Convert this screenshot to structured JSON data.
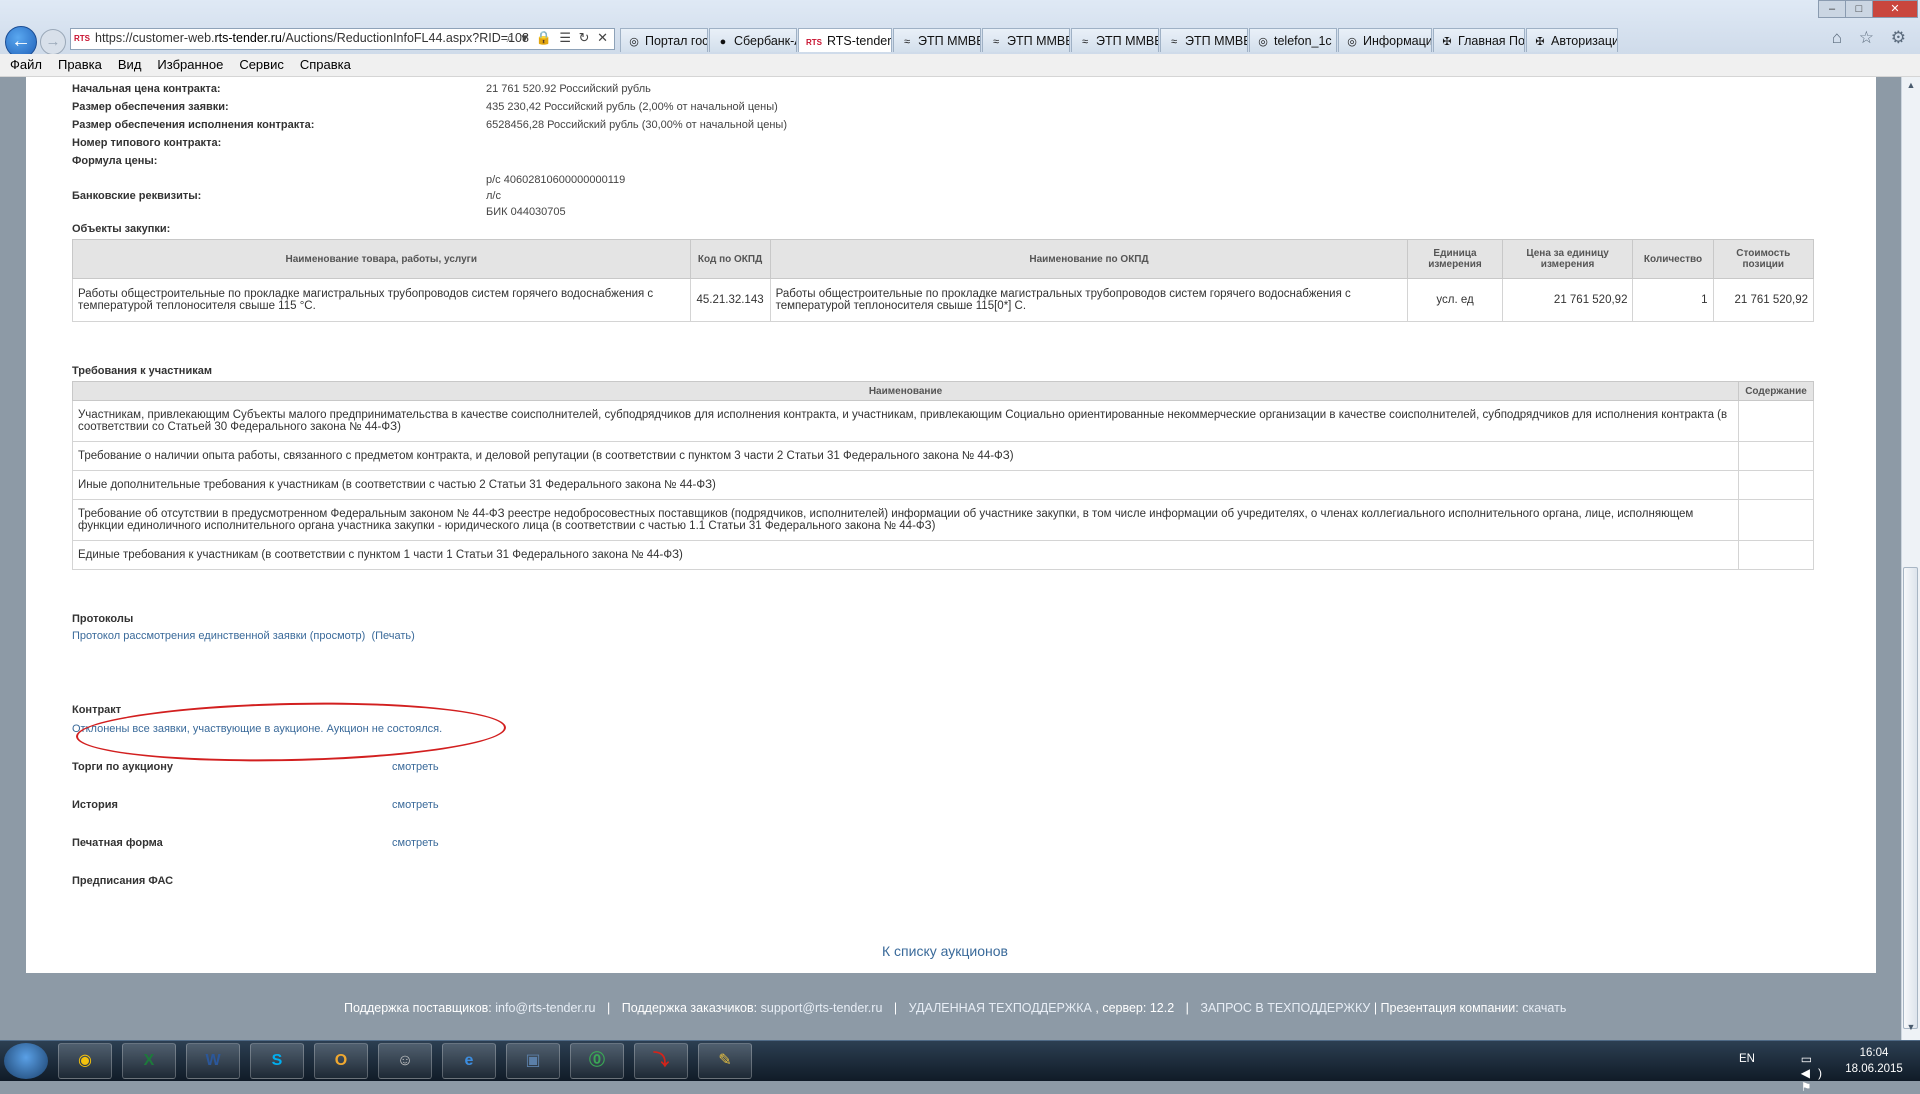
{
  "browser": {
    "url_prefix": "https://customer-web.",
    "url_domain": "rts-tender.ru",
    "url_path": "/Auctions/ReductionInfoFL44.aspx?RID=108",
    "url_icons": "⌕ ▾ 🔒 ☰ ↻ ✕",
    "favicon_text": "RTS",
    "tabs": [
      {
        "label": "Портал госз...",
        "icon": "◎",
        "active": false
      },
      {
        "label": "Сбербанк-А...",
        "icon": "●",
        "active": false
      },
      {
        "label": "RTS-tender",
        "icon": "RTS",
        "active": true
      },
      {
        "label": "ЭТП ММВБ «...",
        "icon": "≈",
        "active": false
      },
      {
        "label": "ЭТП ММВБ «...",
        "icon": "≈",
        "active": false
      },
      {
        "label": "ЭТП ММВБ «...",
        "icon": "≈",
        "active": false
      },
      {
        "label": "ЭТП ММВБ «...",
        "icon": "≈",
        "active": false
      },
      {
        "label": "telefon_1c",
        "icon": "◎",
        "active": false
      },
      {
        "label": "Информация",
        "icon": "◎",
        "active": false
      },
      {
        "label": "Главная Пор...",
        "icon": "✠",
        "active": false
      },
      {
        "label": "Авторизация...",
        "icon": "✠",
        "active": false
      }
    ],
    "tab_close": "✕",
    "menu": [
      "Файл",
      "Правка",
      "Вид",
      "Избранное",
      "Сервис",
      "Справка"
    ],
    "right_icons": "⌂ ☆ ⚙",
    "window_controls": {
      "minimize": "–",
      "maximize": "□",
      "close": "✕"
    }
  },
  "info": [
    {
      "label": "Начальная цена контракта:",
      "value": "21 761 520.92 Российский рубль"
    },
    {
      "label": "Размер обеспечения заявки:",
      "value": "435 230,42 Российский рубль (2,00% от начальной цены)"
    },
    {
      "label": "Размер обеспечения исполнения контракта:",
      "value": "6528456,28 Российский рубль (30,00% от начальной цены)"
    },
    {
      "label": "Номер типового контракта:",
      "value": ""
    },
    {
      "label": "Формула цены:",
      "value": ""
    }
  ],
  "bank": {
    "label": "Банковские реквизиты:",
    "lines": [
      "р/с 40602810600000000119",
      "л/с",
      "БИК 044030705"
    ]
  },
  "goods": {
    "title": "Объекты закупки:",
    "headers": [
      "Наименование товара, работы, услуги",
      "Код по ОКПД",
      "Наименование по ОКПД",
      "Единица измерения",
      "Цена за единицу измерения",
      "Количество",
      "Стоимость позиции"
    ],
    "row": {
      "name": "Работы общестроительные по прокладке магистральных трубопроводов систем горячего водоснабжения с температурой теплоносителя свыше 115 °С.",
      "okpd": "45.21.32.143",
      "okpd_name": "Работы общестроительные по прокладке магистральных трубопроводов систем горячего водоснабжения с температурой теплоносителя свыше 115[0*] С.",
      "unit": "усл. ед",
      "price": "21 761 520,92",
      "qty": "1",
      "total": "21 761 520,92"
    }
  },
  "requirements": {
    "title": "Требования к участникам",
    "headers": [
      "Наименование",
      "Содержание"
    ],
    "rows": [
      "Участникам, привлекающим Субъекты малого предпринимательства в качестве соисполнителей, субподрядчиков для исполнения контракта, и участникам, привлекающим Социально ориентированные некоммерческие организации в качестве соисполнителей, субподрядчиков для исполнения контракта (в соответствии со Статьей 30 Федерального закона № 44-ФЗ)",
      "Требование о наличии опыта работы, связанного с предметом контракта, и деловой репутации (в соответствии с пунктом 3 части 2 Статьи 31 Федерального закона № 44-ФЗ)",
      "Иные дополнительные требования к участникам (в соответствии с частью 2 Статьи 31 Федерального закона № 44-ФЗ)",
      "Требование об отсутствии в предусмотренном Федеральным законом № 44-ФЗ реестре недобросовестных поставщиков (подрядчиков, исполнителей) информации об участнике закупки, в том числе информации об учредителях, о членах коллегиального исполнительного органа, лице, исполняющем функции единоличного исполнительного органа участника закупки - юридического лица (в соответствии с частью 1.1 Статьи 31 Федерального закона № 44-ФЗ)",
      "Единые требования к участникам (в соответствии с пунктом 1 части 1 Статьи 31 Федерального закона № 44-ФЗ)"
    ]
  },
  "protocols": {
    "title": "Протоколы",
    "link": "Протокол рассмотрения единственной заявки (просмотр)",
    "print": "(Печать)"
  },
  "contract": {
    "title": "Контракт",
    "status": "Отклонены все заявки, участвующие в аукционе. Аукцион не состоялся."
  },
  "links": [
    {
      "label": "Торги по аукциону",
      "value": "смотреть"
    },
    {
      "label": "История",
      "value": "смотреть"
    },
    {
      "label": "Печатная форма",
      "value": "смотреть"
    },
    {
      "label": "Предписания ФАС",
      "value": ""
    }
  ],
  "back_to_list": "К списку аукционов",
  "footer": {
    "suppliers_label": "Поддержка поставщиков:",
    "suppliers_email": "info@rts-tender.ru",
    "customers_label": "Поддержка заказчиков:",
    "customers_email": "support@rts-tender.ru",
    "remote_support": "УДАЛЕННАЯ ТЕХПОДДЕРЖКА",
    "server": ", сервер: 12.2",
    "request_support": "ЗАПРОС В ТЕХПОДДЕРЖКУ",
    "presentation_label": "Презентация компании:",
    "presentation_link": "скачать"
  },
  "taskbar": {
    "apps": [
      "chrome-icon",
      "excel-icon",
      "word-icon",
      "skype-icon",
      "outlook-icon",
      "user-icon",
      "ie-icon",
      "network-icon",
      "app-icon",
      "pdf-icon",
      "paint-icon",
      "folder-icon"
    ],
    "lang": "EN",
    "time": "16:04",
    "date": "18.06.2015"
  }
}
